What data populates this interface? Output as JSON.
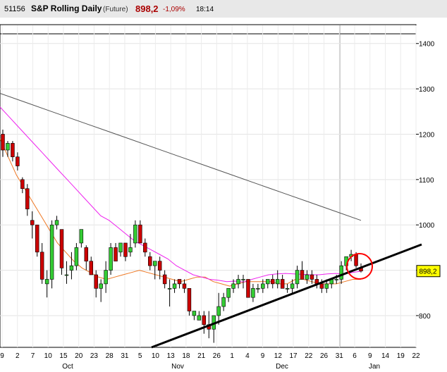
{
  "header": {
    "code": "51156",
    "name": "S&P Rolling Daily",
    "kind": "(Future)",
    "last": "898,2",
    "change": "-1,09%",
    "time": "18:14"
  },
  "colors": {
    "up": "#33cc33",
    "down": "#cc0000",
    "ma_short": "#ee7722",
    "ma_mid": "#ee22ee",
    "ma_long": "#555555",
    "trendline": "#000000",
    "marker": "#ff0000",
    "price_tag": "#ffff00"
  },
  "chart_data": {
    "type": "candlestick",
    "title": "S&P Rolling Daily",
    "ylim": [
      730,
      1440
    ],
    "yticks": [
      800,
      900,
      1000,
      1100,
      1200,
      1300,
      1400
    ],
    "ytick_labels": [
      "800",
      "1000",
      "1100",
      "1200",
      "1300",
      "1400"
    ],
    "price_tag": "898,2",
    "grid": true,
    "xtick_labels": [
      "9",
      "2",
      "7",
      "10",
      "15",
      "20",
      "23",
      "28",
      "31",
      "5",
      "10",
      "13",
      "18",
      "21",
      "26",
      "1",
      "4",
      "9",
      "12",
      "17",
      "22",
      "26",
      "31",
      "6",
      "9",
      "14",
      "19",
      "22"
    ],
    "month_labels": [
      "Oct",
      "Nov",
      "Dec",
      "Jan"
    ],
    "candles": [
      [
        1200,
        1210,
        1150,
        1165
      ],
      [
        1165,
        1185,
        1150,
        1180
      ],
      [
        1180,
        1185,
        1140,
        1150
      ],
      [
        1150,
        1160,
        1120,
        1130
      ],
      [
        1100,
        1105,
        1070,
        1080
      ],
      [
        1080,
        1090,
        1020,
        1035
      ],
      [
        1010,
        1030,
        970,
        1000
      ],
      [
        1000,
        1000,
        930,
        940
      ],
      [
        940,
        960,
        870,
        880
      ],
      [
        870,
        900,
        840,
        880
      ],
      [
        880,
        1010,
        860,
        1000
      ],
      [
        1000,
        1020,
        990,
        1010
      ],
      [
        990,
        990,
        890,
        905
      ],
      [
        890,
        920,
        870,
        890
      ],
      [
        900,
        940,
        880,
        910
      ],
      [
        910,
        960,
        900,
        950
      ],
      [
        960,
        990,
        950,
        990
      ],
      [
        950,
        955,
        900,
        920
      ],
      [
        920,
        930,
        890,
        890
      ],
      [
        890,
        900,
        840,
        860
      ],
      [
        860,
        880,
        830,
        870
      ],
      [
        870,
        920,
        850,
        900
      ],
      [
        900,
        960,
        890,
        950
      ],
      [
        950,
        960,
        920,
        920
      ],
      [
        940,
        960,
        930,
        960
      ],
      [
        960,
        960,
        920,
        930
      ],
      [
        940,
        980,
        930,
        950
      ],
      [
        960,
        1010,
        950,
        1000
      ],
      [
        1000,
        1010,
        960,
        960
      ],
      [
        960,
        970,
        930,
        940
      ],
      [
        930,
        940,
        900,
        910
      ],
      [
        910,
        920,
        880,
        920
      ],
      [
        920,
        930,
        880,
        900
      ],
      [
        890,
        900,
        860,
        870
      ],
      [
        860,
        880,
        820,
        860
      ],
      [
        860,
        880,
        850,
        870
      ],
      [
        880,
        880,
        860,
        870
      ],
      [
        870,
        880,
        850,
        860
      ],
      [
        860,
        860,
        800,
        810
      ],
      [
        800,
        810,
        790,
        810
      ],
      [
        790,
        810,
        800,
        800
      ],
      [
        800,
        810,
        760,
        780
      ],
      [
        780,
        810,
        750,
        770
      ],
      [
        770,
        800,
        740,
        800
      ],
      [
        800,
        850,
        780,
        820
      ],
      [
        820,
        850,
        810,
        840
      ],
      [
        840,
        860,
        830,
        860
      ],
      [
        860,
        880,
        850,
        870
      ],
      [
        870,
        890,
        860,
        880
      ],
      [
        880,
        890,
        860,
        880
      ],
      [
        880,
        880,
        840,
        840
      ],
      [
        840,
        870,
        830,
        860
      ],
      [
        860,
        870,
        850,
        860
      ],
      [
        860,
        880,
        850,
        870
      ],
      [
        870,
        880,
        860,
        880
      ],
      [
        880,
        890,
        860,
        870
      ],
      [
        870,
        900,
        860,
        880
      ],
      [
        880,
        890,
        860,
        860
      ],
      [
        860,
        870,
        850,
        860
      ],
      [
        860,
        880,
        850,
        870
      ],
      [
        870,
        910,
        860,
        900
      ],
      [
        900,
        920,
        880,
        880
      ],
      [
        880,
        900,
        870,
        890
      ],
      [
        890,
        900,
        870,
        880
      ],
      [
        880,
        890,
        860,
        870
      ],
      [
        870,
        880,
        850,
        860
      ],
      [
        860,
        880,
        850,
        870
      ],
      [
        870,
        880,
        860,
        880
      ],
      [
        880,
        890,
        870,
        880
      ],
      [
        880,
        920,
        870,
        910
      ],
      [
        910,
        930,
        900,
        930
      ],
      [
        930,
        945,
        920,
        935
      ],
      [
        935,
        940,
        905,
        910
      ],
      [
        905,
        915,
        895,
        898.2
      ]
    ],
    "series": [
      {
        "values": [
          1190,
          1150,
          1110,
          1080,
          1050,
          1020,
          990,
          960,
          940,
          920,
          905,
          895,
          885,
          880,
          885,
          890,
          895,
          900,
          895,
          890,
          885,
          880,
          875,
          880,
          885,
          885,
          875,
          870,
          865,
          870,
          875,
          875,
          875,
          875,
          870,
          870,
          880,
          880,
          875,
          870,
          870,
          870,
          875,
          880,
          880
        ]
      },
      {
        "values": [
          1260,
          1240,
          1220,
          1200,
          1180,
          1160,
          1140,
          1120,
          1100,
          1080,
          1060,
          1040,
          1020,
          1010,
          995,
          980,
          965,
          955,
          945,
          935,
          925,
          910,
          900,
          890,
          885,
          880,
          878,
          875,
          876,
          874,
          880,
          885,
          890,
          892,
          893,
          892,
          891,
          890,
          890,
          892,
          893,
          892,
          895,
          898
        ]
      },
      {
        "values": [
          1290,
          1270,
          1250,
          1230,
          1210,
          1190,
          1170,
          1150,
          1130,
          1110,
          1090,
          1070,
          1050,
          1030,
          1010
        ]
      }
    ]
  }
}
